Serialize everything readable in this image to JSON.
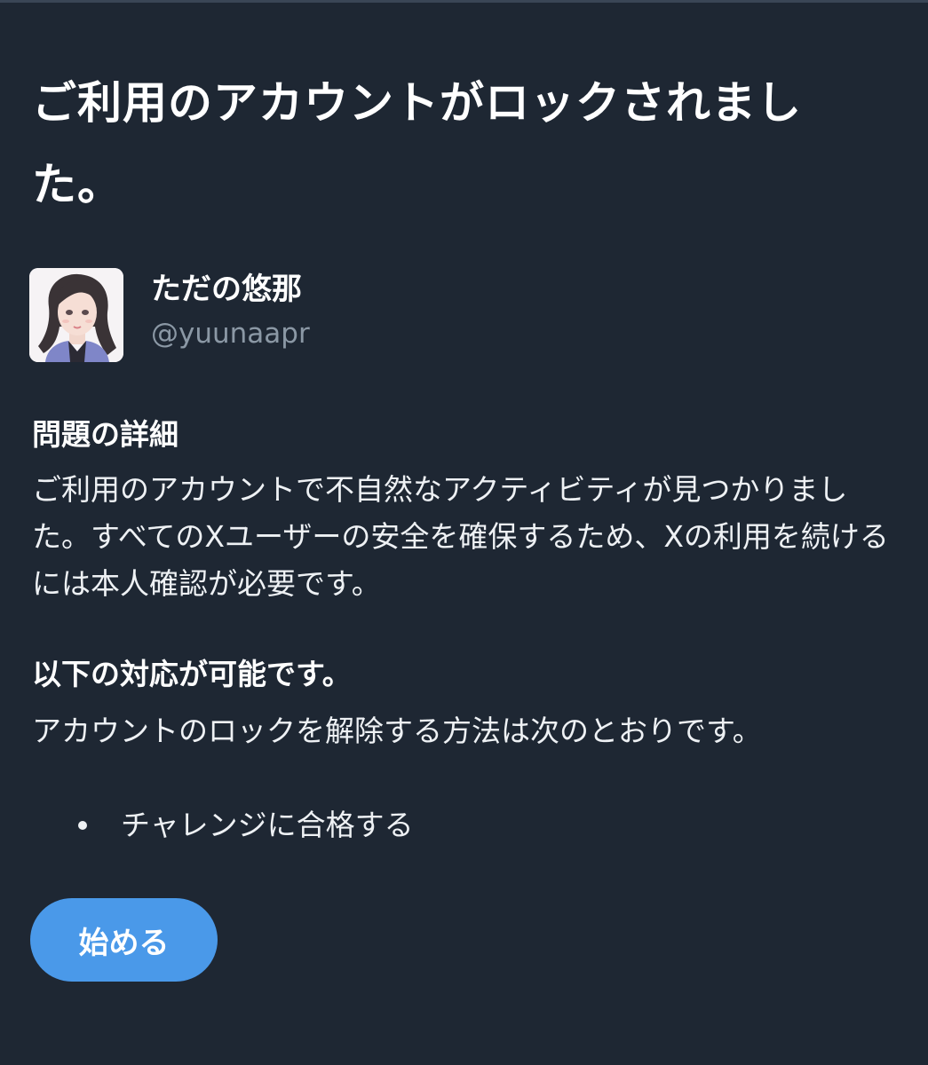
{
  "title": "ご利用のアカウントがロックされました。",
  "profile": {
    "display_name": "ただの悠那",
    "handle": "@yuunaapr"
  },
  "details": {
    "heading": "問題の詳細",
    "body": "ご利用のアカウントで不自然なアクティビティが見つかりました。すべてのXユーザーの安全を確保するため、Xの利用を続けるには本人確認が必要です。"
  },
  "options": {
    "heading": "以下の対応が可能です。",
    "body": "アカウントのロックを解除する方法は次のとおりです。",
    "items": [
      "チャレンジに合格する"
    ]
  },
  "start_button": {
    "label": "始める"
  },
  "colors": {
    "background": "#1e2733",
    "accent": "#4a99e9",
    "secondary_text": "#8b98a5"
  }
}
